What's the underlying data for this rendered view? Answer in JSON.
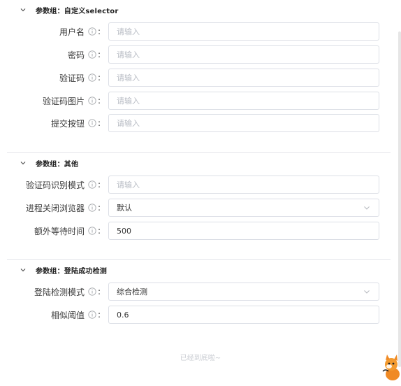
{
  "sections": [
    {
      "title": "参数组：自定义selector",
      "fields": [
        {
          "label": "用户名",
          "placeholder": "请输入"
        },
        {
          "label": "密码",
          "placeholder": "请输入"
        },
        {
          "label": "验证码",
          "placeholder": "请输入"
        },
        {
          "label": "验证码图片",
          "placeholder": "请输入"
        },
        {
          "label": "提交按钮",
          "placeholder": "请输入"
        }
      ]
    },
    {
      "title": "参数组：其他",
      "fields": [
        {
          "label": "验证码识别模式",
          "placeholder": "请输入"
        },
        {
          "label": "进程关闭浏览器",
          "value": "默认"
        },
        {
          "label": "额外等待时间",
          "value": "500"
        }
      ]
    },
    {
      "title": "参数组：登陆成功检测",
      "fields": [
        {
          "label": "登陆检测模式",
          "value": "综合检测"
        },
        {
          "label": "相似阈值",
          "value": "0.6"
        }
      ]
    }
  ],
  "colon": ":",
  "footer": "已经到底啦~",
  "colors": {
    "border": "#dcdfe6",
    "placeholder": "#b8bcc4",
    "divider": "#e5e6eb"
  },
  "icons": {
    "section_toggle": "chevron-down-icon",
    "help": "info-circle-icon",
    "select": "chevron-down-icon"
  }
}
